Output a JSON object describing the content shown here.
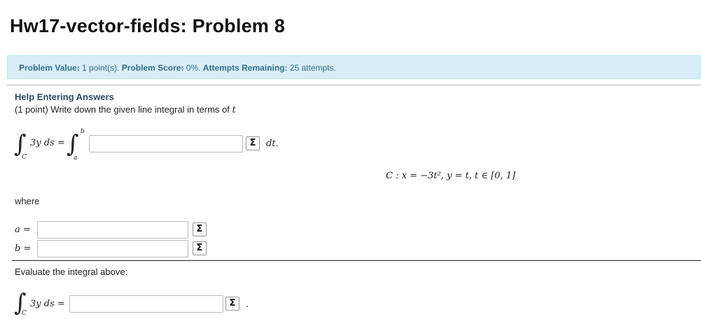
{
  "page": {
    "title": "Hw17-vector-fields: Problem 8"
  },
  "infobar": {
    "value_label": "Problem Value:",
    "value_text": " 1 point(s). ",
    "score_label": "Problem Score:",
    "score_text": " 0%. ",
    "attempts_label": "Attempts Remaining:",
    "attempts_text": " 25 attempts."
  },
  "problem": {
    "help_link": "Help Entering Answers",
    "intro_text": "(1 point) Write down the given line integral in terms of",
    "intro_var": "t",
    "integral_symbol": "∫",
    "lhs_sub": "C",
    "lhs_expr": "3y ds =",
    "rhs_sup": "b",
    "rhs_sub": "a",
    "dt_label": "dt.",
    "curve_def": "C : x = −3t², y = t, t ∈ [0, 1]",
    "where_label": "where",
    "a_label": "a =",
    "b_label": "b =",
    "evaluate_label": "Evaluate the integral above:",
    "eval_expr": "3y ds =",
    "eval_period": "."
  },
  "inputs": {
    "integrand_value": "",
    "a_value": "",
    "b_value": "",
    "result_value": ""
  },
  "buttons": {
    "equation_editor_label": "Σ"
  },
  "colors": {
    "info_bg": "#d9edf7",
    "info_text": "#31708f",
    "help_link": "#2a4b68"
  }
}
